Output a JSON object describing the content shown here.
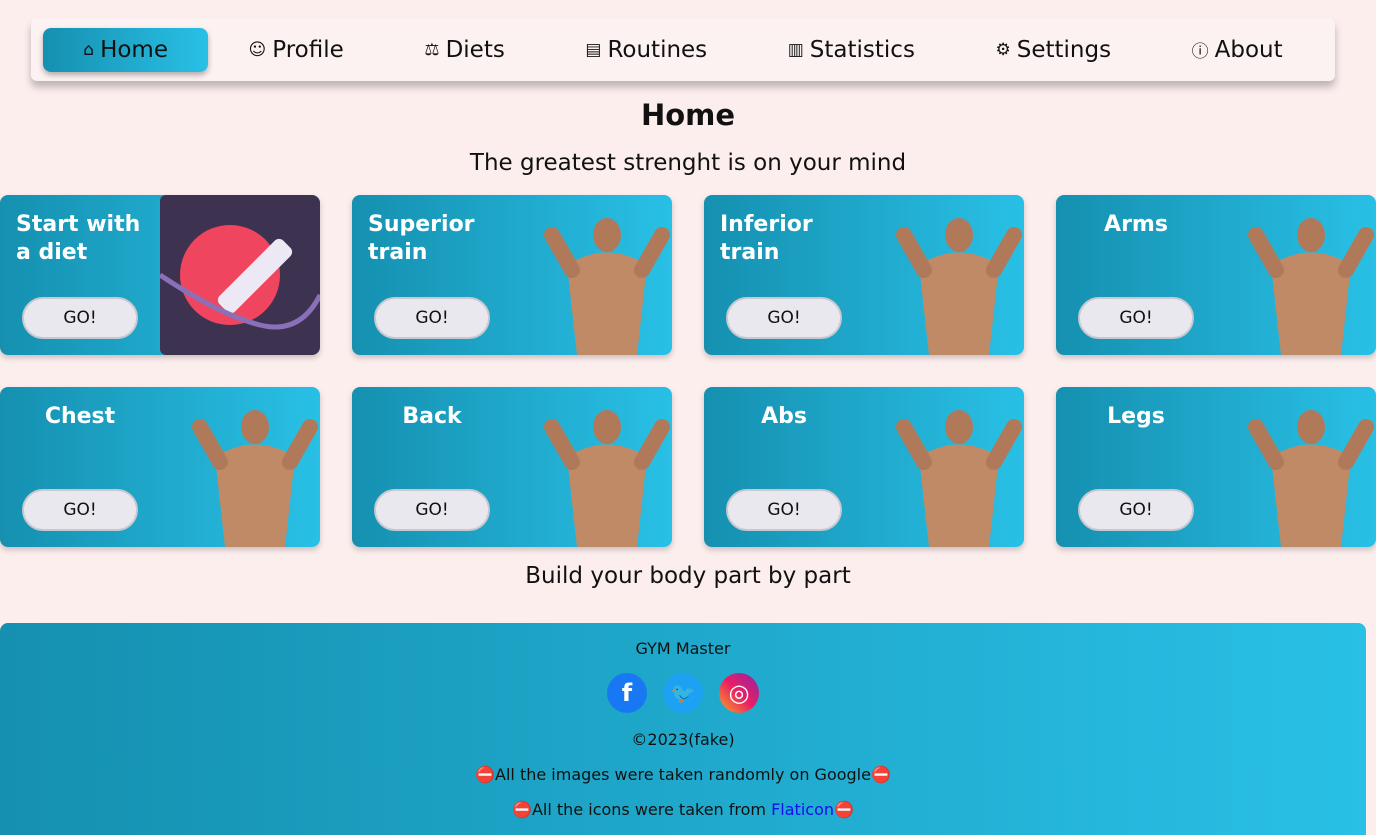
{
  "nav": [
    {
      "label": "Home",
      "icon": "⌂"
    },
    {
      "label": "Profile",
      "icon": "☺"
    },
    {
      "label": "Diets",
      "icon": "⚖"
    },
    {
      "label": "Routines",
      "icon": "▤"
    },
    {
      "label": "Statistics",
      "icon": "▥"
    },
    {
      "label": "Settings",
      "icon": "⚙"
    },
    {
      "label": "About",
      "icon": "ⓘ"
    }
  ],
  "page_title": "Home",
  "tagline": "The greatest strenght is on your mind",
  "cards": [
    {
      "title": "Start with a diet",
      "button": "GO!"
    },
    {
      "title": "Superior train",
      "button": "GO!"
    },
    {
      "title": "Inferior train",
      "button": "GO!"
    },
    {
      "title": "Arms",
      "button": "GO!"
    },
    {
      "title": "Chest",
      "button": "GO!"
    },
    {
      "title": "Back",
      "button": "GO!"
    },
    {
      "title": "Abs",
      "button": "GO!"
    },
    {
      "title": "Legs",
      "button": "GO!"
    }
  ],
  "bottom_tagline": "Build your body part by part",
  "footer": {
    "brand": "GYM Master",
    "copyright": "©2023(fake)",
    "note1": "All the images were taken randomly on Google",
    "note2_prefix": "All the icons were taken from ",
    "note2_link": "Flaticon",
    "no_entry": "⛔"
  },
  "colors": {
    "gradient_start": "#1590b0",
    "gradient_end": "#29c0e6",
    "background": "#fdeeee"
  }
}
